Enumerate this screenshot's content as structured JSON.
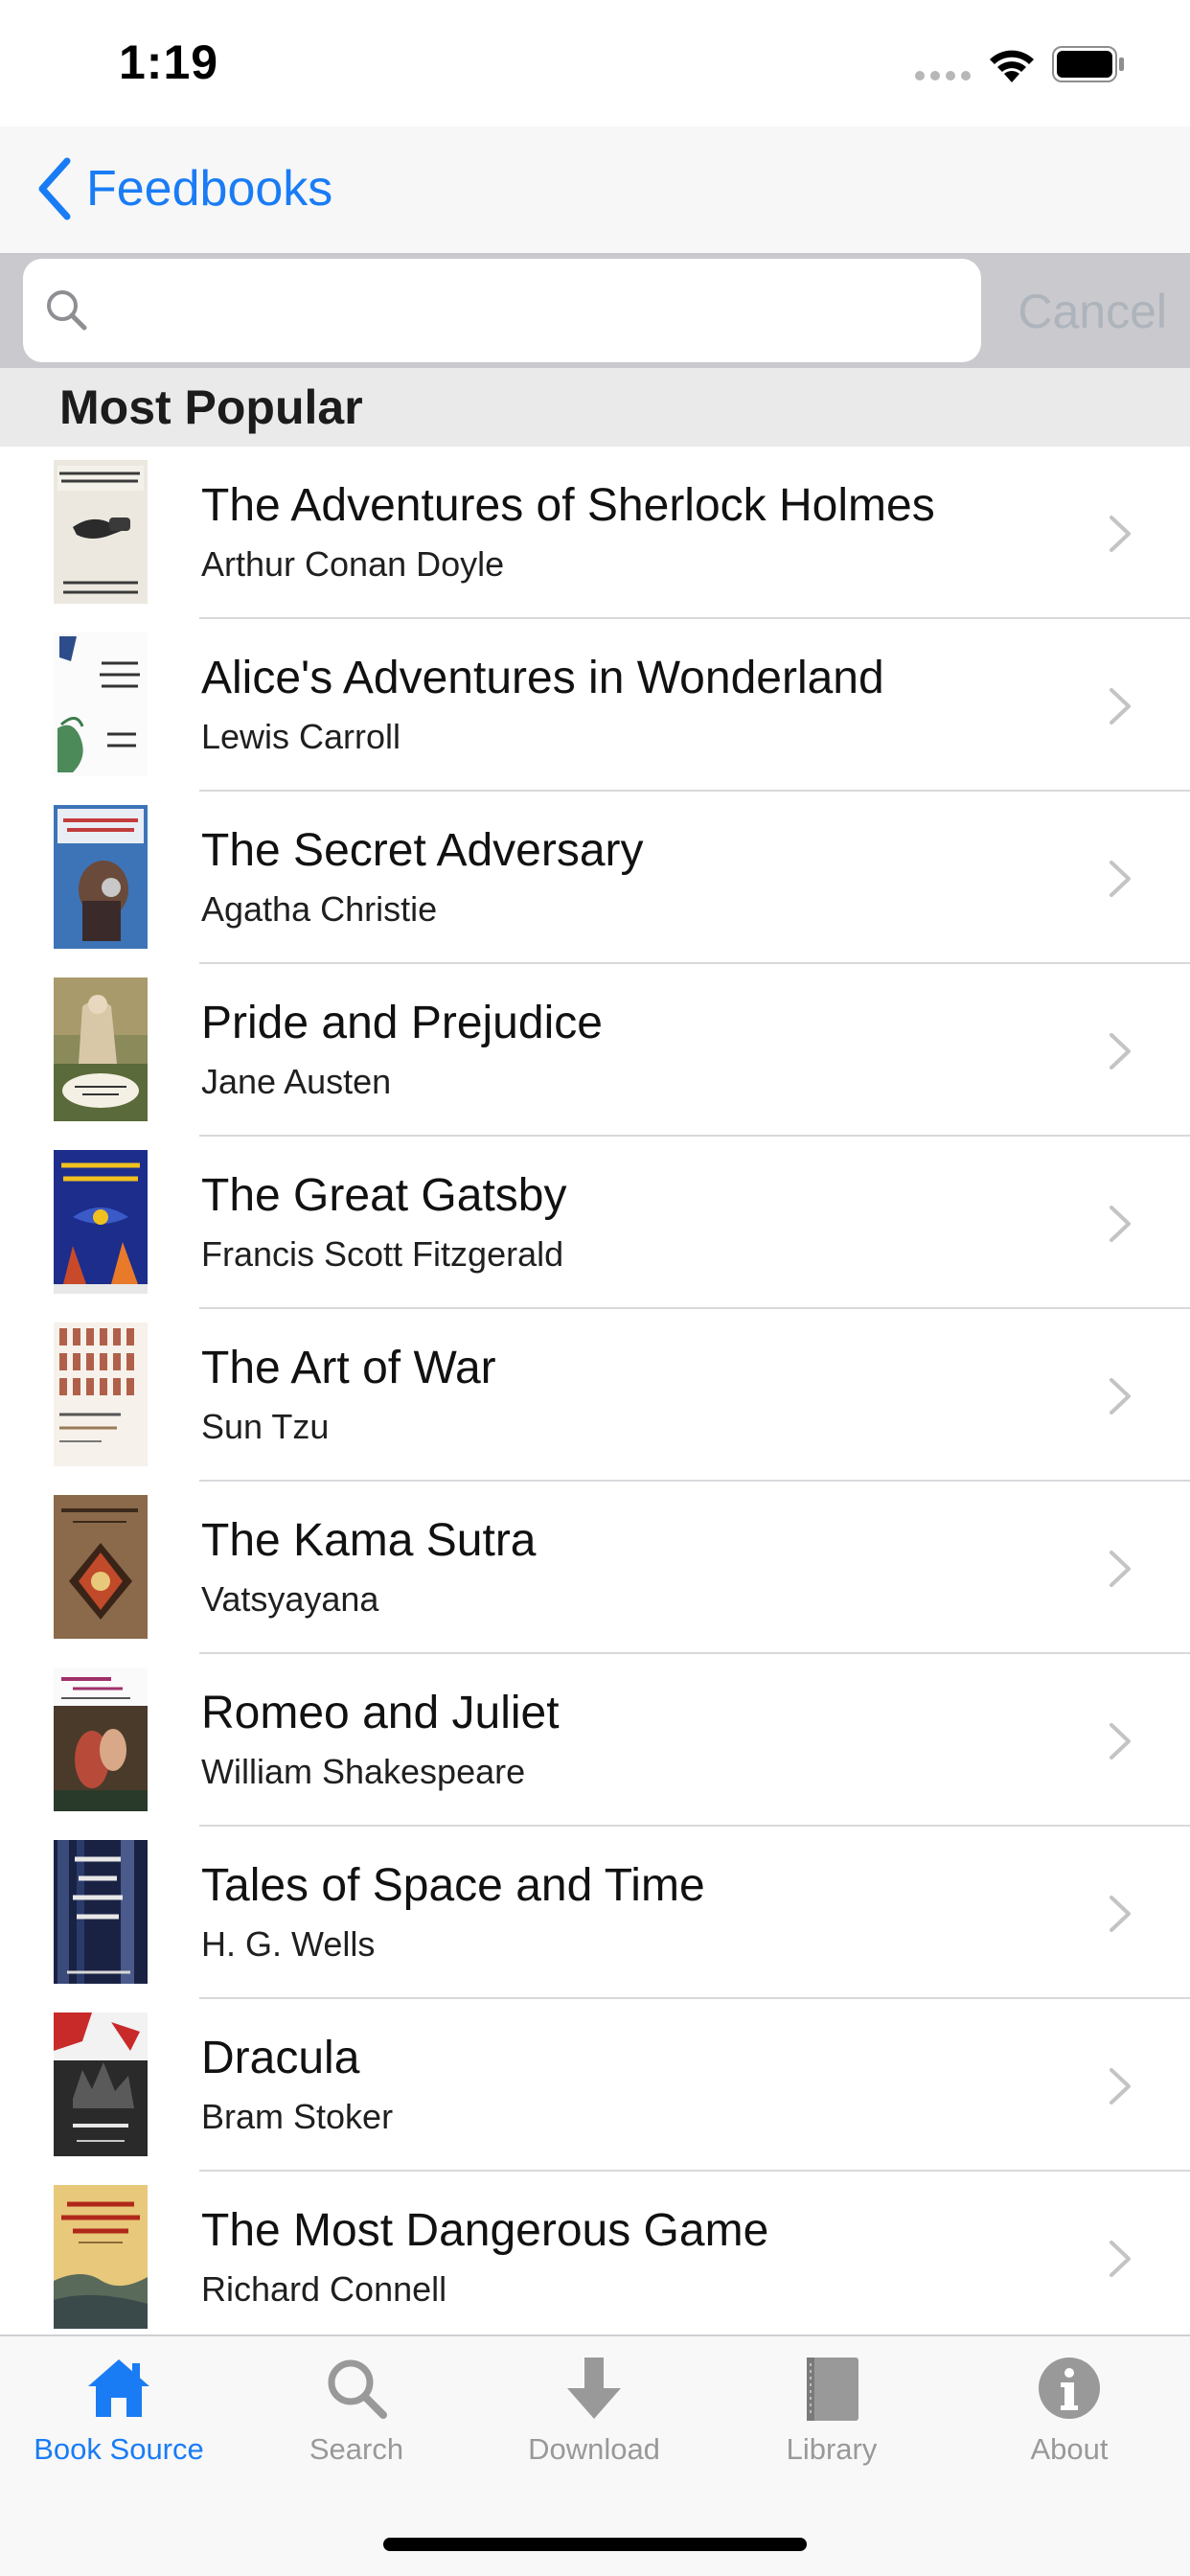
{
  "status_bar": {
    "time": "1:19"
  },
  "nav": {
    "back_label": "Feedbooks",
    "accent_color": "#1a7cf5"
  },
  "search": {
    "placeholder": "",
    "value": "",
    "cancel_label": "Cancel"
  },
  "section": {
    "title": "Most Popular"
  },
  "books": [
    {
      "title": "The Adventures of Sherlock Holmes",
      "author": "Arthur Conan Doyle"
    },
    {
      "title": "Alice's Adventures in Wonderland",
      "author": "Lewis Carroll"
    },
    {
      "title": "The Secret Adversary",
      "author": "Agatha Christie"
    },
    {
      "title": "Pride and Prejudice",
      "author": "Jane Austen"
    },
    {
      "title": "The Great Gatsby",
      "author": "Francis Scott Fitzgerald"
    },
    {
      "title": "The Art of War",
      "author": "Sun Tzu"
    },
    {
      "title": "The Kama Sutra",
      "author": "Vatsyayana"
    },
    {
      "title": "Romeo and Juliet",
      "author": "William Shakespeare"
    },
    {
      "title": "Tales of Space and Time",
      "author": "H. G. Wells"
    },
    {
      "title": "Dracula",
      "author": "Bram Stoker"
    },
    {
      "title": "The Most Dangerous Game",
      "author": "Richard Connell"
    }
  ],
  "tabs": [
    {
      "label": "Book Source",
      "icon": "house-icon",
      "active": true
    },
    {
      "label": "Search",
      "icon": "search-icon",
      "active": false
    },
    {
      "label": "Download",
      "icon": "download-icon",
      "active": false
    },
    {
      "label": "Library",
      "icon": "book-icon",
      "active": false
    },
    {
      "label": "About",
      "icon": "info-icon",
      "active": false
    }
  ]
}
